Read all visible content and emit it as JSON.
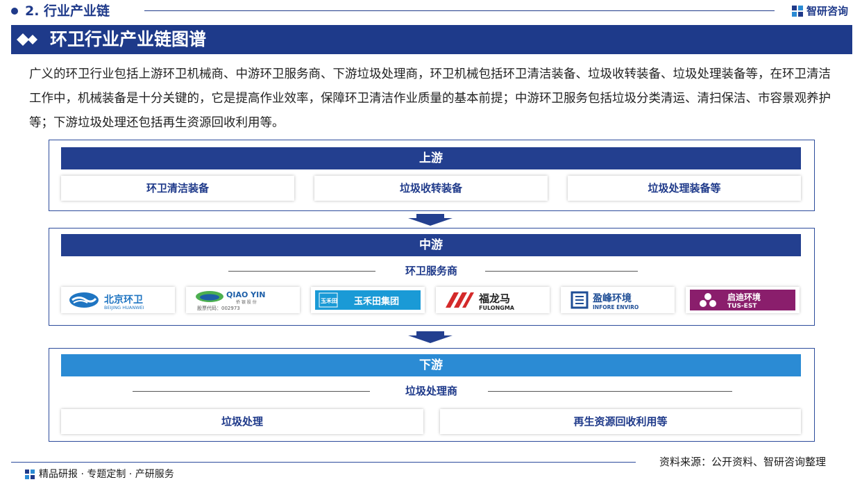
{
  "section": {
    "title": "2. 行业产业链"
  },
  "brand": {
    "name": "智研咨询"
  },
  "banner": {
    "title": "环卫行业产业链图谱"
  },
  "intro": "广义的环卫行业包括上游环卫机械商、中游环卫服务商、下游垃圾处理商，环卫机械包括环卫清洁装备、垃圾收转装备、垃圾处理装备等，在环卫清洁工作中，机械装备是十分关键的，它是提高作业效率，保障环卫清洁作业质量的基本前提；中游环卫服务包括垃圾分类清运、清扫保洁、市容景观养护等；下游垃圾处理还包括再生资源回收利用等。",
  "upstream": {
    "title": "上游",
    "items": [
      "环卫清洁装备",
      "垃圾收转装备",
      "垃圾处理装备等"
    ]
  },
  "midstream": {
    "title": "中游",
    "subtitle": "环卫服务商",
    "logos": [
      {
        "name": "北京环卫",
        "sub": "BEIJING HUANWEI"
      },
      {
        "name": "QIAO YIN",
        "sub": "侨 银 股 份",
        "code": "股票代码：002973"
      },
      {
        "name": "玉禾田集团",
        "mark": "玉禾田"
      },
      {
        "name": "福龙马",
        "sub": "FULONGMA"
      },
      {
        "name": "盈峰环境",
        "sub": "INFORE ENVIRO"
      },
      {
        "name": "启迪环境",
        "sub": "TUS-EST"
      }
    ]
  },
  "downstream": {
    "title": "下游",
    "subtitle": "垃圾处理商",
    "items": [
      "垃圾处理",
      "再生资源回收利用等"
    ]
  },
  "footer": {
    "source": "资料来源：公开资料、智研咨询整理",
    "tagline": "精品研报 · 专题定制 · 产研服务"
  },
  "colors": {
    "navy": "#1e3a8a",
    "blue_bar": "#2b8bd4",
    "card_text": "#1f3a8a"
  }
}
